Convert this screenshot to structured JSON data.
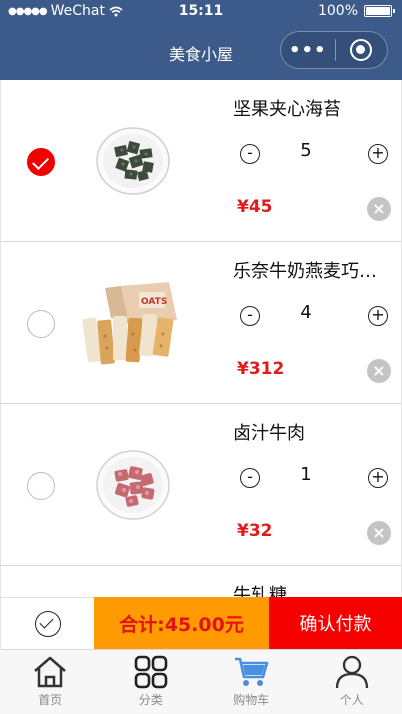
{
  "status_bar": {
    "carrier": "WeChat",
    "time": "15:11",
    "battery": "100%"
  },
  "nav": {
    "title": "美食小屋",
    "more_icon": "ellipsis-icon",
    "close_icon": "target-icon"
  },
  "cart": {
    "items": [
      {
        "name": "坚果夹心海苔",
        "quantity": "5",
        "price": "¥45",
        "selected": true,
        "image": "seaweed-snack-image"
      },
      {
        "name": "乐奈牛奶燕麦巧克力",
        "quantity": "4",
        "price": "¥312",
        "selected": false,
        "image": "oat-chocolate-box-image"
      },
      {
        "name": "卤汁牛肉",
        "quantity": "1",
        "price": "¥32",
        "selected": false,
        "image": "braised-beef-image"
      },
      {
        "name": "牛轧糖",
        "quantity": "",
        "price": "",
        "selected": false,
        "image": "nougat-image"
      }
    ],
    "minus_symbol": "-",
    "plus_symbol": "+",
    "remove_symbol": "×"
  },
  "action_bar": {
    "total": "合计:45.00元",
    "pay_label": "确认付款"
  },
  "tabs": [
    {
      "label": "首页",
      "icon": "home-icon"
    },
    {
      "label": "分类",
      "icon": "category-grid-icon"
    },
    {
      "label": "购物车",
      "icon": "cart-icon"
    },
    {
      "label": "个人",
      "icon": "person-icon"
    }
  ],
  "colors": {
    "nav_bg": "#3c5b8a",
    "price": "#e21a1a",
    "total_bg": "#ff9a00",
    "pay_bg": "#f70000",
    "active_tab": "#4a90e2"
  }
}
